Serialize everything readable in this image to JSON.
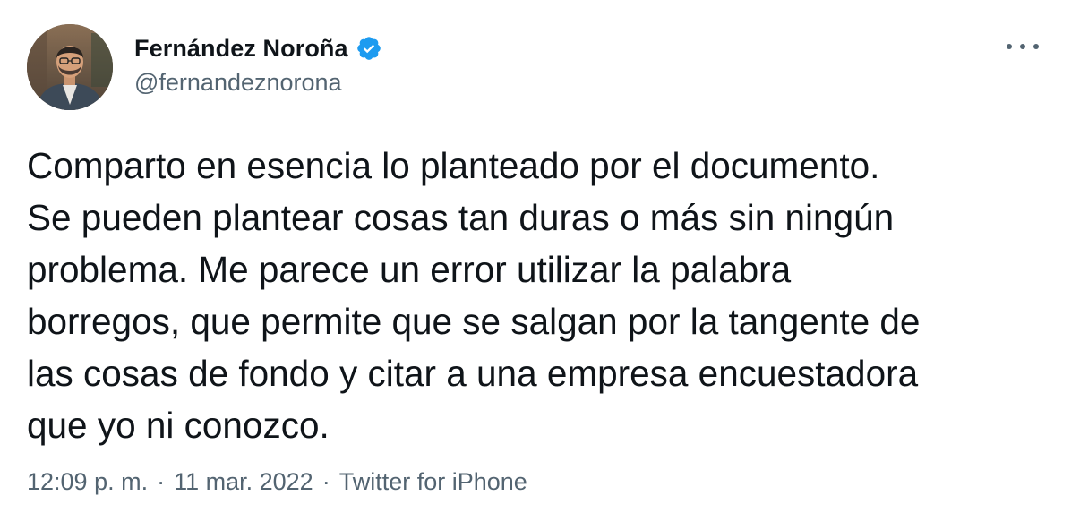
{
  "author": {
    "display_name": "Fernández Noroña",
    "handle": "@fernandeznorona",
    "verified": true,
    "avatar_icon": "profile-photo"
  },
  "menu": {
    "more_icon": "more-horizontal-icon"
  },
  "tweet": {
    "text": "Comparto en esencia lo planteado por el documento.\nSe pueden plantear cosas tan duras o más sin ningún\nproblema. Me parece un error utilizar la palabra\nborregos, que permite que se salgan por la tangente de\nlas cosas de fondo y citar a una empresa encuestadora\nque yo ni conozco."
  },
  "meta": {
    "time": "12:09 p. m.",
    "separator": "·",
    "date": "11 mar. 2022",
    "source": "Twitter for iPhone"
  },
  "colors": {
    "text_primary": "#0f1419",
    "text_secondary": "#536471",
    "verified_blue": "#1d9bf0",
    "background": "#ffffff"
  }
}
